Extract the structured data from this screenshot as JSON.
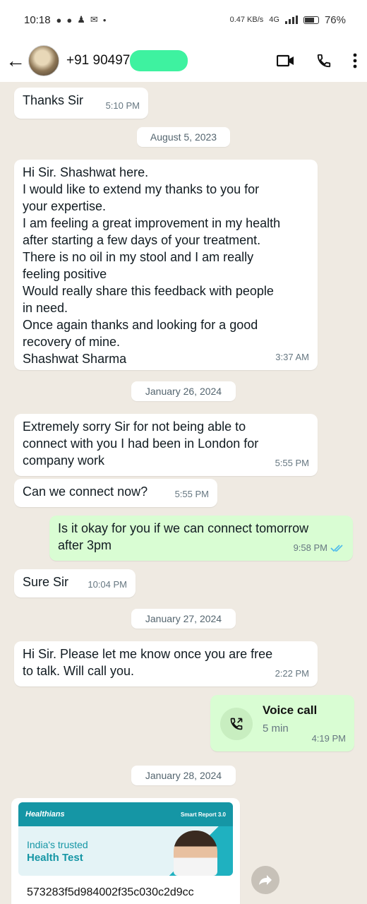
{
  "status_bar": {
    "time": "10:18",
    "net_speed": "0.47 KB/s",
    "network": "4G",
    "battery": "76%"
  },
  "header": {
    "contact_name": "+91 90497"
  },
  "dates": {
    "d1": "August 5, 2023",
    "d2": "January 26, 2024",
    "d3": "January 27, 2024",
    "d4": "January 28, 2024"
  },
  "messages": [
    {
      "text": "Thanks Sir",
      "time": "5:10 PM"
    },
    {
      "text": "Hi Sir. Shashwat here.\nI would like to extend my thanks to you for\nyour expertise.\nI am feeling a great improvement in my health\nafter starting a few days of your treatment.\nThere is no oil in my stool and I am really\nfeeling positive\nWould really share this feedback with people\nin need.\nOnce again thanks and looking for a good\nrecovery of mine.\nShashwat Sharma",
      "time": "3:37 AM"
    },
    {
      "text": "Extremely sorry Sir for not being able to\nconnect with you I had been in London for\ncompany work",
      "time": "5:55 PM"
    },
    {
      "text": "Can we connect now?",
      "time": "5:55 PM"
    },
    {
      "text": "Is it okay for you if we can connect tomorrow\nafter 3pm",
      "time": "9:58 PM"
    },
    {
      "text": "Sure Sir",
      "time": "10:04 PM"
    },
    {
      "text": "Hi Sir. Please let me know once you are free\nto talk. Will call you.",
      "time": "2:22 PM"
    }
  ],
  "voice_call": {
    "title": "Voice call",
    "duration": "5 min",
    "time": "4:19 PM"
  },
  "report_card": {
    "brand": "Healthians",
    "badge": "Smart Report 3.0",
    "line1": "India's trusted",
    "line2": "Health Test",
    "link_text": "573283f5d984002f35c030c2d9cc"
  },
  "colors": {
    "chat_bg": "#efeae2",
    "outgoing": "#d9fdd3",
    "incoming": "#ffffff",
    "redaction": "#3ef2a0",
    "read_ticks": "#53bdeb"
  }
}
